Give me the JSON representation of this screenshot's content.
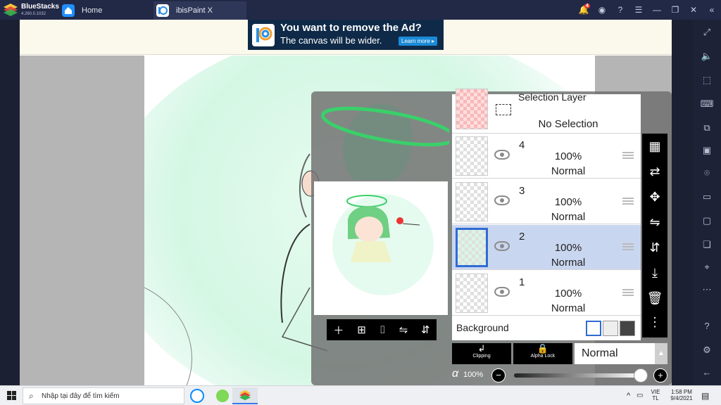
{
  "window": {
    "brand": "BlueStacks",
    "version": "4.260.0.1032",
    "tabs": [
      {
        "label": "Home"
      },
      {
        "label": "ibisPaint X"
      }
    ],
    "notification_count": "4"
  },
  "ad": {
    "headline": "You want to remove the Ad?",
    "subline": "The canvas will be wider.",
    "button": "Learn more ▸"
  },
  "layers": {
    "selection_title": "Selection Layer",
    "selection_state": "No Selection",
    "items": [
      {
        "number": "4",
        "opacity": "100%",
        "mode": "Normal"
      },
      {
        "number": "3",
        "opacity": "100%",
        "mode": "Normal"
      },
      {
        "number": "2",
        "opacity": "100%",
        "mode": "Normal",
        "selected": true
      },
      {
        "number": "1",
        "opacity": "100%",
        "mode": "Normal"
      }
    ],
    "background_label": "Background",
    "clipping_label": "Clipping",
    "alpha_lock_label": "Alpha Lock",
    "blend_mode": "Normal",
    "alpha_symbol": "α",
    "opacity_value": "100%",
    "opacity_level": 1.0
  },
  "taskbar": {
    "search_placeholder": "Nhập tại đây để tìm kiếm",
    "language_top": "VIE",
    "language_bottom": "TL",
    "time": "1:58 PM",
    "date": "9/4/2021"
  },
  "colors": {
    "titlebar": "#222946",
    "accent_blue": "#2f6bd3",
    "canvas_green": "#d4f7e4"
  }
}
